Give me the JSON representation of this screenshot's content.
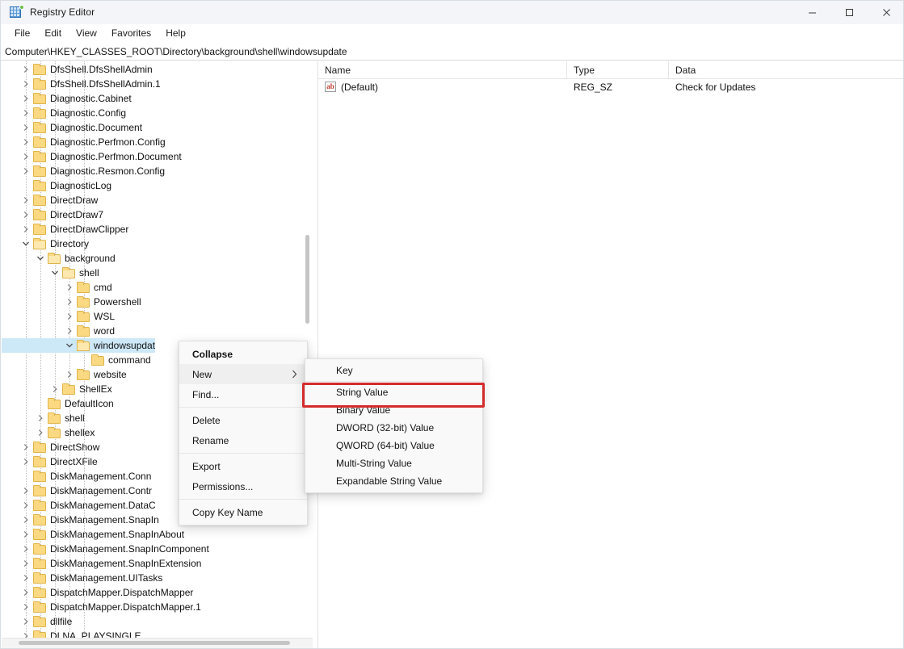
{
  "window": {
    "title": "Registry Editor",
    "app_icon": "registry-icon",
    "controls": {
      "minimize": "minimize-icon",
      "maximize": "maximize-icon",
      "close": "close-icon"
    }
  },
  "menubar": {
    "items": [
      {
        "label": "File"
      },
      {
        "label": "Edit"
      },
      {
        "label": "View"
      },
      {
        "label": "Favorites"
      },
      {
        "label": "Help"
      }
    ]
  },
  "address": {
    "path": "Computer\\HKEY_CLASSES_ROOT\\Directory\\background\\shell\\windowsupdate"
  },
  "tree": {
    "nodes": [
      {
        "label": "DfsShell.DfsShellAdmin",
        "depth": 1,
        "state": "collapsed"
      },
      {
        "label": "DfsShell.DfsShellAdmin.1",
        "depth": 1,
        "state": "collapsed"
      },
      {
        "label": "Diagnostic.Cabinet",
        "depth": 1,
        "state": "collapsed"
      },
      {
        "label": "Diagnostic.Config",
        "depth": 1,
        "state": "collapsed"
      },
      {
        "label": "Diagnostic.Document",
        "depth": 1,
        "state": "collapsed"
      },
      {
        "label": "Diagnostic.Perfmon.Config",
        "depth": 1,
        "state": "collapsed"
      },
      {
        "label": "Diagnostic.Perfmon.Document",
        "depth": 1,
        "state": "collapsed"
      },
      {
        "label": "Diagnostic.Resmon.Config",
        "depth": 1,
        "state": "collapsed"
      },
      {
        "label": "DiagnosticLog",
        "depth": 1,
        "state": "leaf"
      },
      {
        "label": "DirectDraw",
        "depth": 1,
        "state": "collapsed"
      },
      {
        "label": "DirectDraw7",
        "depth": 1,
        "state": "collapsed"
      },
      {
        "label": "DirectDrawClipper",
        "depth": 1,
        "state": "collapsed"
      },
      {
        "label": "Directory",
        "depth": 1,
        "state": "expanded"
      },
      {
        "label": "background",
        "depth": 2,
        "state": "expanded"
      },
      {
        "label": "shell",
        "depth": 3,
        "state": "expanded"
      },
      {
        "label": "cmd",
        "depth": 4,
        "state": "collapsed"
      },
      {
        "label": "Powershell",
        "depth": 4,
        "state": "collapsed"
      },
      {
        "label": "WSL",
        "depth": 4,
        "state": "collapsed"
      },
      {
        "label": "word",
        "depth": 4,
        "state": "collapsed"
      },
      {
        "label": "windowsupdat",
        "depth": 4,
        "state": "expanded",
        "selected": true
      },
      {
        "label": "command",
        "depth": 5,
        "state": "leaf"
      },
      {
        "label": "website",
        "depth": 4,
        "state": "collapsed"
      },
      {
        "label": "ShellEx",
        "depth": 3,
        "state": "collapsed"
      },
      {
        "label": "DefaultIcon",
        "depth": 2,
        "state": "leaf"
      },
      {
        "label": "shell",
        "depth": 2,
        "state": "collapsed"
      },
      {
        "label": "shellex",
        "depth": 2,
        "state": "collapsed"
      },
      {
        "label": "DirectShow",
        "depth": 1,
        "state": "collapsed"
      },
      {
        "label": "DirectXFile",
        "depth": 1,
        "state": "collapsed"
      },
      {
        "label": "DiskManagement.Conn",
        "depth": 1,
        "state": "leaf"
      },
      {
        "label": "DiskManagement.Contr",
        "depth": 1,
        "state": "collapsed"
      },
      {
        "label": "DiskManagement.DataC",
        "depth": 1,
        "state": "collapsed"
      },
      {
        "label": "DiskManagement.SnapIn",
        "depth": 1,
        "state": "collapsed"
      },
      {
        "label": "DiskManagement.SnapInAbout",
        "depth": 1,
        "state": "collapsed"
      },
      {
        "label": "DiskManagement.SnapInComponent",
        "depth": 1,
        "state": "collapsed"
      },
      {
        "label": "DiskManagement.SnapInExtension",
        "depth": 1,
        "state": "collapsed"
      },
      {
        "label": "DiskManagement.UITasks",
        "depth": 1,
        "state": "collapsed"
      },
      {
        "label": "DispatchMapper.DispatchMapper",
        "depth": 1,
        "state": "collapsed"
      },
      {
        "label": "DispatchMapper.DispatchMapper.1",
        "depth": 1,
        "state": "collapsed"
      },
      {
        "label": "dllfile",
        "depth": 1,
        "state": "collapsed"
      },
      {
        "label": "DLNA_PLAYSINGLE",
        "depth": 1,
        "state": "collapsed"
      }
    ]
  },
  "values": {
    "columns": [
      "Name",
      "Type",
      "Data"
    ],
    "rows": [
      {
        "name": "(Default)",
        "icon": "ab",
        "type": "REG_SZ",
        "data": "Check for Updates"
      }
    ]
  },
  "context_menu": {
    "items": [
      {
        "label": "Collapse",
        "bold": true,
        "separator_after": false
      },
      {
        "label": "New",
        "submenu": true,
        "hover": true
      },
      {
        "label": "Find...",
        "separator_after": true
      },
      {
        "label": "Delete"
      },
      {
        "label": "Rename",
        "separator_after": true
      },
      {
        "label": "Export"
      },
      {
        "label": "Permissions...",
        "separator_after": true
      },
      {
        "label": "Copy Key Name"
      }
    ]
  },
  "submenu": {
    "items": [
      {
        "label": "Key",
        "separator_after": true
      },
      {
        "label": "String Value",
        "highlighted": true
      },
      {
        "label": "Binary Value"
      },
      {
        "label": "DWORD (32-bit) Value"
      },
      {
        "label": "QWORD (64-bit) Value"
      },
      {
        "label": "Multi-String Value"
      },
      {
        "label": "Expandable String Value"
      }
    ]
  },
  "annotation": {
    "highlight_color": "#d42b2b",
    "target": "String Value"
  }
}
